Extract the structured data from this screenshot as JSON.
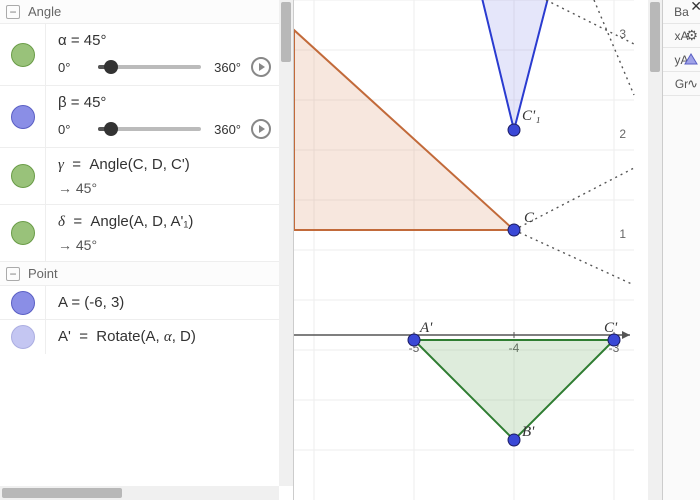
{
  "sections": {
    "angle": "Angle",
    "point": "Point"
  },
  "alpha": {
    "formula": "α = 45°",
    "min": "0°",
    "max": "360°",
    "percent": 12.5
  },
  "beta": {
    "formula": "β = 45°",
    "min": "0°",
    "max": "360°",
    "percent": 12.5
  },
  "gamma": {
    "formula": "γ  =  Angle(C, D, C')",
    "value": "→   45°"
  },
  "delta": {
    "formula": "δ  =  Angle(A, D, A'₁)",
    "value": "→   45°"
  },
  "ptA": {
    "formula": "A  =  (-6, 3)"
  },
  "ptAp": {
    "formula": "A'  =  Rotate(A, α, D)"
  },
  "axis": {
    "ticks": [
      "-5",
      "-4",
      "-3",
      "1",
      "2",
      "3"
    ]
  },
  "labels": {
    "C": "C",
    "Cp1": "C'₁",
    "Ap": "A'",
    "Bp": "B'",
    "Cp": "C'"
  },
  "side": {
    "ba": "Ba",
    "xa": "xA",
    "ya": "yA",
    "gr": "Gr"
  },
  "chart_data": {
    "type": "scatter",
    "title": "",
    "xlabel": "",
    "ylabel": "",
    "xlim": [
      -6.2,
      -2.5
    ],
    "ylim": [
      -1.2,
      3.4
    ],
    "series": [
      {
        "name": "green-triangle",
        "type": "polygon",
        "points": [
          [
            -5.0,
            -0.05
          ],
          [
            -3.0,
            -0.05
          ],
          [
            -4.0,
            -1.05
          ]
        ]
      },
      {
        "name": "orange-triangle",
        "type": "polygon",
        "points": [
          [
            -6.2,
            1.0
          ],
          [
            -4.0,
            1.0
          ],
          [
            -6.2,
            3.0
          ]
        ]
      },
      {
        "name": "blue-triangle-clip",
        "type": "polygon",
        "points": [
          [
            -4.3,
            3.4
          ],
          [
            -4.0,
            2.0
          ],
          [
            -3.6,
            3.4
          ]
        ]
      }
    ],
    "points": [
      {
        "name": "C",
        "x": -4.0,
        "y": 1.0
      },
      {
        "name": "C'₁",
        "x": -4.0,
        "y": 2.0
      },
      {
        "name": "A'",
        "x": -5.0,
        "y": -0.05
      },
      {
        "name": "B'",
        "x": -4.0,
        "y": -1.05
      },
      {
        "name": "C'",
        "x": -3.0,
        "y": -0.05
      }
    ]
  }
}
